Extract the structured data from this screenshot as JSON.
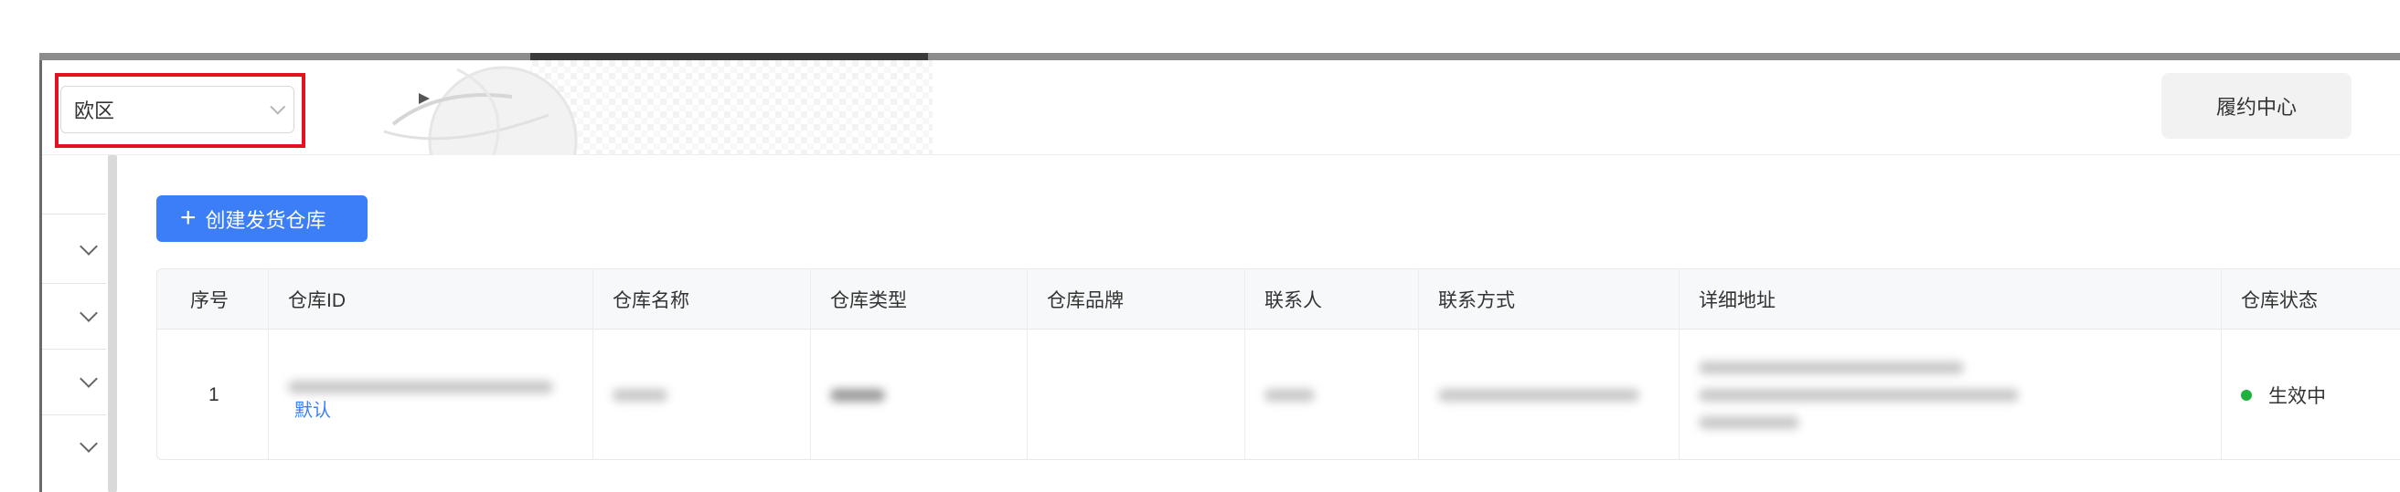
{
  "header": {
    "region_value": "欧区",
    "fulfillment_button": "履约中心"
  },
  "toolbar": {
    "create_button": "创建发货仓库"
  },
  "table": {
    "columns": [
      "序号",
      "仓库ID",
      "仓库名称",
      "仓库类型",
      "仓库品牌",
      "联系人",
      "联系方式",
      "详细地址",
      "仓库状态"
    ],
    "rows": [
      {
        "index": "1",
        "tag": "默认",
        "status": "生效中"
      }
    ]
  },
  "colors": {
    "primary": "#3c7ef7",
    "highlight": "#e0131f",
    "status_active": "#1fb13d"
  },
  "icons": [
    "chevron-down-icon",
    "plus-icon",
    "status-dot-icon"
  ]
}
